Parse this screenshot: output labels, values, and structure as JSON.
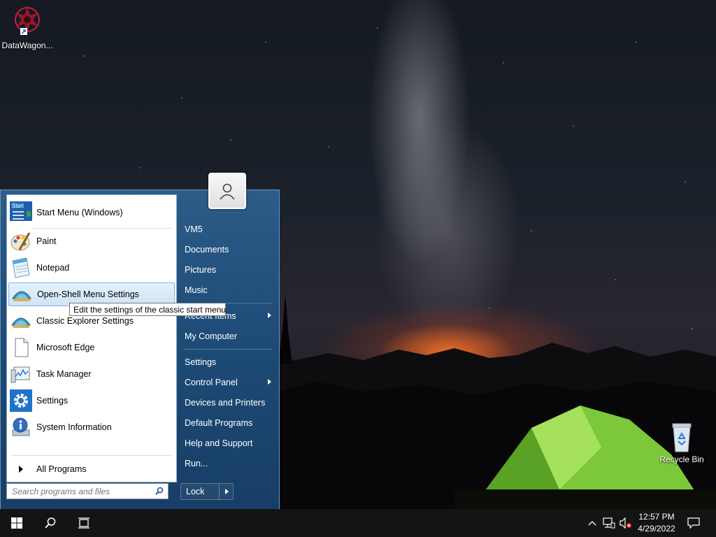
{
  "desktop": {
    "icons": [
      {
        "label": "DataWagon..."
      },
      {
        "label": "Recycle Bin"
      }
    ]
  },
  "start_menu": {
    "pinned": [
      {
        "label": "Start Menu (Windows)",
        "icon": "start-menu-icon"
      }
    ],
    "programs": [
      {
        "label": "Paint",
        "icon": "paint-icon"
      },
      {
        "label": "Notepad",
        "icon": "notepad-icon"
      },
      {
        "label": "Open-Shell Menu Settings",
        "icon": "shell-icon",
        "highlighted": true
      },
      {
        "label": "Classic Explorer Settings",
        "icon": "shell-icon"
      },
      {
        "label": "Microsoft Edge",
        "icon": "document-icon"
      },
      {
        "label": "Task Manager",
        "icon": "task-manager-icon"
      },
      {
        "label": "Settings",
        "icon": "gear-icon"
      },
      {
        "label": "System Information",
        "icon": "info-icon"
      }
    ],
    "all_programs": "All Programs",
    "search_placeholder": "Search programs and files",
    "tooltip": "Edit the settings of the classic start menu",
    "right_items": [
      {
        "label": "VM5",
        "has_submenu": false
      },
      {
        "label": "Documents",
        "has_submenu": false
      },
      {
        "label": "Pictures",
        "has_submenu": false
      },
      {
        "label": "Music",
        "has_submenu": false
      },
      {
        "label": "Recent Items",
        "has_submenu": true
      },
      {
        "label": "My Computer",
        "has_submenu": false
      },
      {
        "label": "Settings",
        "has_submenu": false
      },
      {
        "label": "Control Panel",
        "has_submenu": true
      },
      {
        "label": "Devices and Printers",
        "has_submenu": false
      },
      {
        "label": "Default Programs",
        "has_submenu": false
      },
      {
        "label": "Help and Support",
        "has_submenu": false
      },
      {
        "label": "Run...",
        "has_submenu": false
      }
    ],
    "lock_label": "Lock"
  },
  "taskbar": {
    "time": "12:57 PM",
    "date": "4/29/2022"
  },
  "colors": {
    "menu_blue": "#1d4a76",
    "highlight": "#cfe4f7",
    "taskbar": "#141414"
  }
}
